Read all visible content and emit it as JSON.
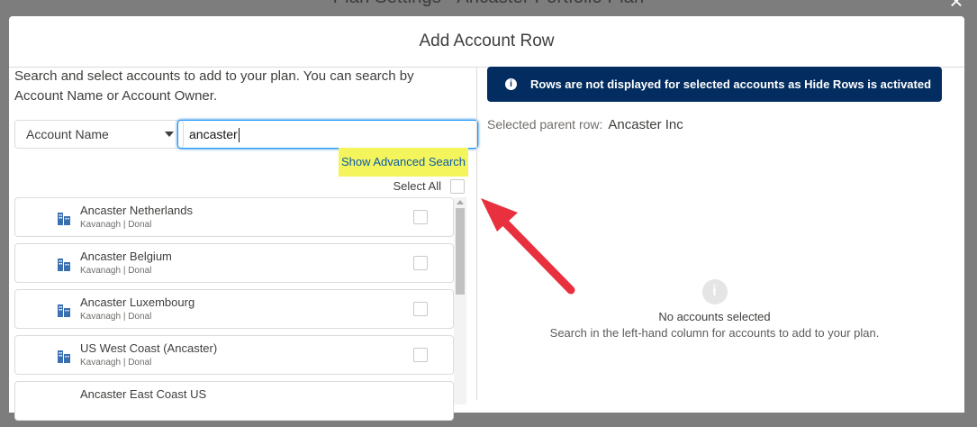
{
  "background": {
    "title": "Plan Settings - Ancaster Portfolio Plan",
    "close_glyph": "×"
  },
  "modal": {
    "title": "Add Account Row"
  },
  "left": {
    "intro": "Search and select accounts to add to your plan. You can search by Account Name or Account Owner.",
    "search_by": "Account Name",
    "search_value": "ancaster",
    "advanced_search": "Show Advanced Search",
    "select_all": "Select All",
    "accounts": [
      {
        "name": "Ancaster Netherlands",
        "owner": "Kavanagh | Donal"
      },
      {
        "name": "Ancaster Belgium",
        "owner": "Kavanagh | Donal"
      },
      {
        "name": "Ancaster Luxembourg",
        "owner": "Kavanagh | Donal"
      },
      {
        "name": "US West Coast (Ancaster)",
        "owner": "Kavanagh | Donal"
      },
      {
        "name": "Ancaster East Coast US",
        "owner": ""
      }
    ]
  },
  "right": {
    "banner_text": "Rows are not displayed for selected accounts as Hide Rows is activated",
    "banner_icon": "i",
    "parent_label": "Selected parent row:",
    "parent_value": "Ancaster Inc",
    "empty_icon": "i",
    "empty_title": "No accounts selected",
    "empty_hint": "Search in the left-hand column for accounts to add to your plan."
  },
  "colors": {
    "banner": "#032d60",
    "highlight": "#f4f45c",
    "link": "#0b5cab",
    "arrow": "#e8303f"
  }
}
